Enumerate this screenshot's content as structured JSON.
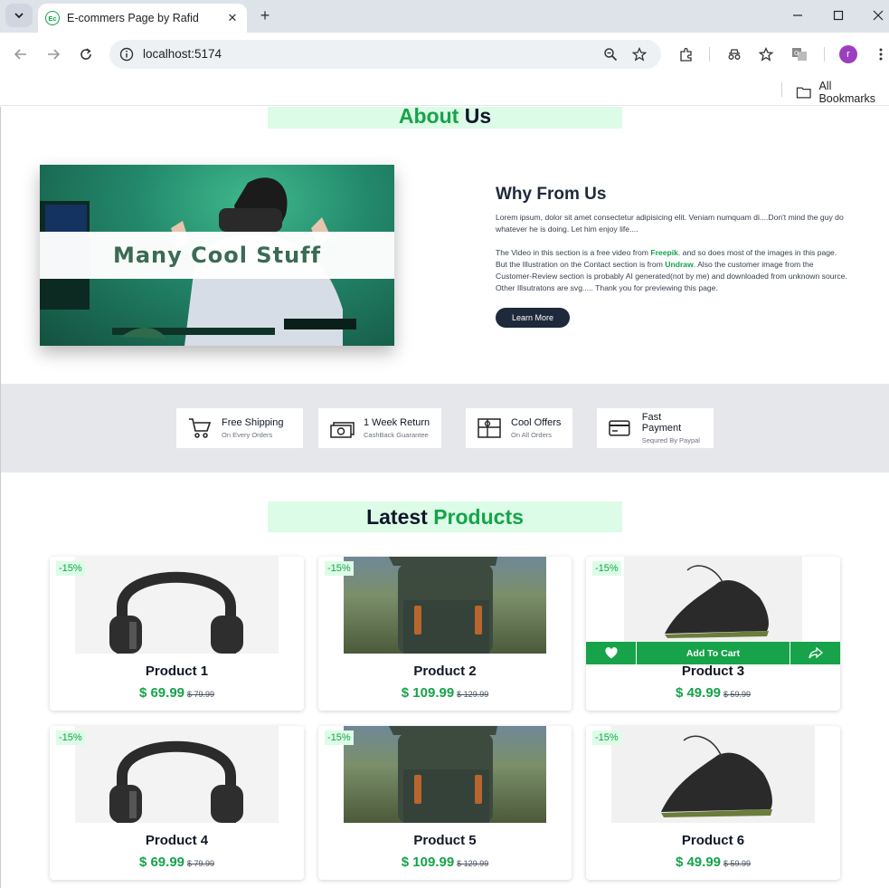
{
  "browser": {
    "tab_title": "E-commers Page by Rafid",
    "favicon_text": "Ec",
    "url": "localhost:5174",
    "profile_initial": "r",
    "bookmarks_label": "All Bookmarks"
  },
  "about": {
    "title_part1": "About",
    "title_part2": "Us",
    "hero_text": "Many Cool Stuff",
    "why_title": "Why From Us",
    "para1": "Lorem ipsum, dolor sit amet consectetur adipisicing elit. Veniam numquam di....Don't mind the guy do whatever he is doing. Let him enjoy life....",
    "para2_a": "The Video in this section is a free video from ",
    "link_freepik": "Freepik",
    "para2_b": ". and so does most of the images in this page. But the Illustration on the Contact section is from ",
    "link_undraw": "Undraw",
    "para2_c": ". Also the customer image from the Customer-Review section is probably AI generated(not by me) and downloaded from unknown source. Other Illsutratons are svg..... Thank you for previewing this page.",
    "learn_more": "Learn More"
  },
  "features": [
    {
      "title": "Free Shipping",
      "sub": "On Every Orders",
      "icon": "cart-icon"
    },
    {
      "title": "1 Week Return",
      "sub": "CashBack Guarantee",
      "icon": "cash-icon"
    },
    {
      "title": "Cool Offers",
      "sub": "On All Orders",
      "icon": "gift-icon"
    },
    {
      "title": "Fast Payment",
      "sub": "Sequred By Paypal",
      "icon": "card-icon"
    }
  ],
  "products_section": {
    "title_part1": "Latest",
    "title_part2": "Products"
  },
  "cart_bar": {
    "add_label": "Add To Cart"
  },
  "products": [
    {
      "name": "Product 1",
      "price": "$ 69.99",
      "old": "$ 79.99",
      "badge": "-15%",
      "image": "headphones"
    },
    {
      "name": "Product 2",
      "price": "$ 109.99",
      "old": "$ 129.99",
      "badge": "-15%",
      "image": "backpack"
    },
    {
      "name": "Product 3",
      "price": "$ 49.99",
      "old": "$ 59.99",
      "badge": "-15%",
      "image": "sneaker"
    },
    {
      "name": "Product 4",
      "price": "$ 69.99",
      "old": "$ 79.99",
      "badge": "-15%",
      "image": "headphones"
    },
    {
      "name": "Product 5",
      "price": "$ 109.99",
      "old": "$ 129.99",
      "badge": "-15%",
      "image": "backpack"
    },
    {
      "name": "Product 6",
      "price": "$ 49.99",
      "old": "$ 59.99",
      "badge": "-15%",
      "image": "sneaker"
    }
  ],
  "colors": {
    "accent": "#16a34a",
    "accent_light": "#dcfce7",
    "dark": "#1e293b"
  }
}
